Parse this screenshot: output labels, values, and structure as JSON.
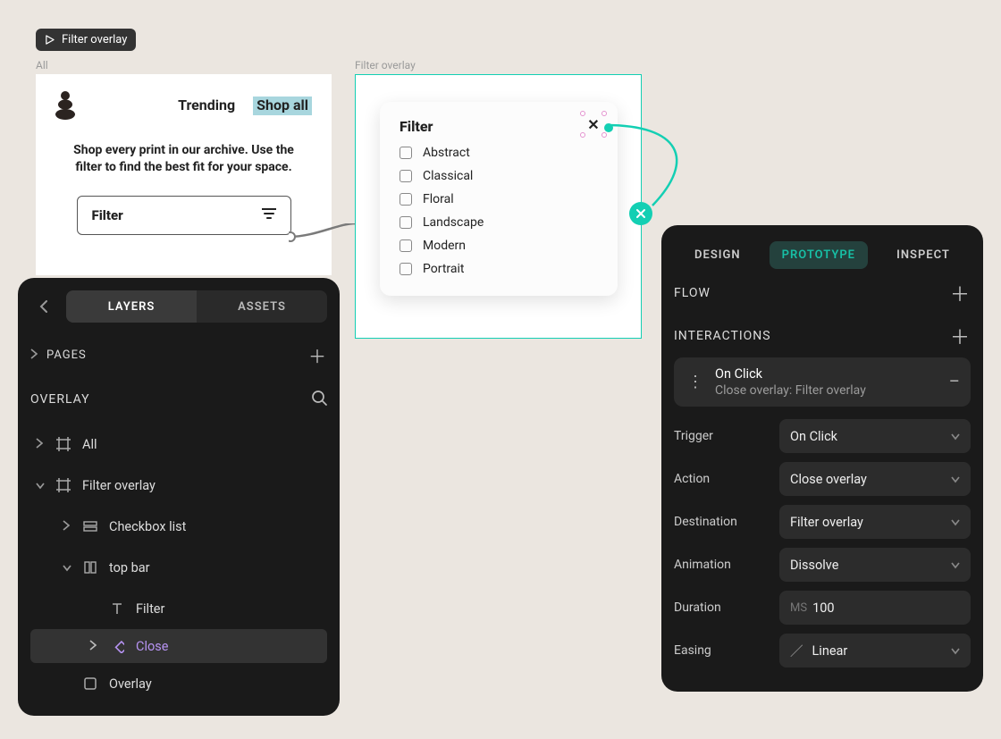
{
  "top_tag": {
    "label": "Filter overlay"
  },
  "frames": {
    "all_label": "All",
    "filter_overlay_label": "Filter overlay"
  },
  "all_frame": {
    "trending": "Trending",
    "shopall": "Shop all",
    "hero_line1": "Shop every print in our archive. Use the",
    "hero_line2": "filter to find the best fit for your space.",
    "filter_btn": "Filter"
  },
  "filter_card": {
    "title": "Filter",
    "items": [
      "Abstract",
      "Classical",
      "Floral",
      "Landscape",
      "Modern",
      "Portrait"
    ]
  },
  "left_panel": {
    "seg": {
      "layers": "LAYERS",
      "assets": "ASSETS"
    },
    "pages": "PAGES",
    "overlay": "OVERLAY",
    "tree": {
      "all": "All",
      "filter_overlay": "Filter overlay",
      "checkbox_list": "Checkbox list",
      "top_bar": "top bar",
      "filter_text": "Filter",
      "close": "Close",
      "overlay_node": "Overlay"
    }
  },
  "right_panel": {
    "tabs": {
      "design": "DESIGN",
      "prototype": "PROTOTYPE",
      "inspect": "INSPECT"
    },
    "flow": "FLOW",
    "interactions": "INTERACTIONS",
    "card": {
      "title": "On Click",
      "sub": "Close overlay: Filter overlay"
    },
    "rows": {
      "trigger": {
        "label": "Trigger",
        "value": "On Click"
      },
      "action": {
        "label": "Action",
        "value": "Close overlay"
      },
      "destination": {
        "label": "Destination",
        "value": "Filter overlay"
      },
      "animation": {
        "label": "Animation",
        "value": "Dissolve"
      },
      "duration": {
        "label": "Duration",
        "prefix": "MS",
        "value": "100"
      },
      "easing": {
        "label": "Easing",
        "value": "Linear"
      }
    }
  }
}
